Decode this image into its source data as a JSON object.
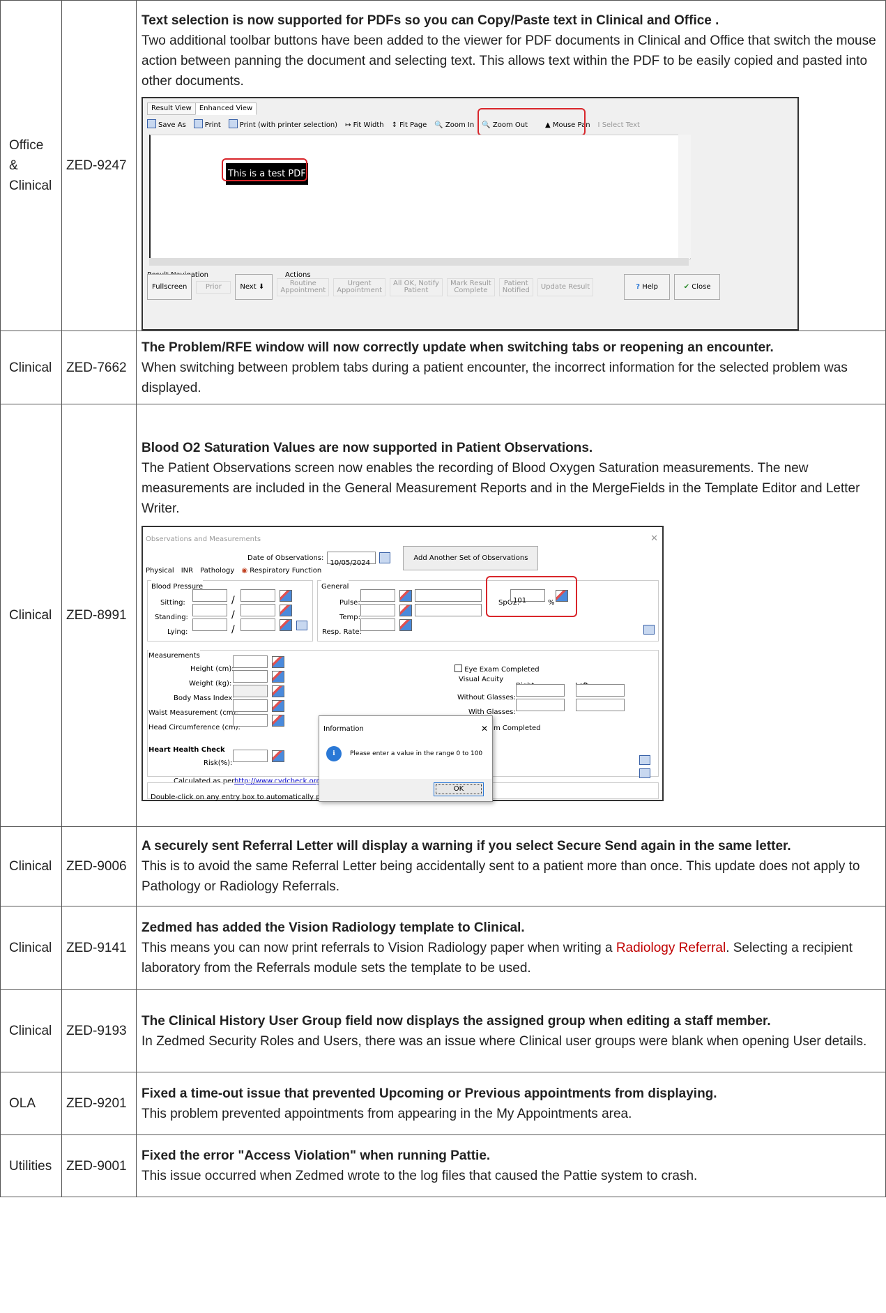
{
  "rows": [
    {
      "area": [
        "Office &",
        "Clinical"
      ],
      "code": "ZED-9247",
      "title": "Text selection is now supported for PDFs so you can Copy/Paste text in Clinical and Office .",
      "body": "Two additional toolbar buttons have been added to the viewer for PDF documents in Clinical and Office that switch the mouse action between panning the document and selecting text. This allows text within the PDF to be easily copied and pasted into other documents."
    },
    {
      "area": [
        "Clinical"
      ],
      "code": "ZED-7662",
      "title": "The Problem/RFE window will now correctly update when switching tabs or reopening an encounter.",
      "body": "When switching between problem tabs during a patient encounter, the incorrect information for the selected problem was displayed."
    },
    {
      "area": [
        "Clinical"
      ],
      "code": "ZED-8991",
      "title": "Blood O2 Saturation Values are now supported in Patient Observations.",
      "body": "The Patient Observations screen now enables the recording of Blood Oxygen Saturation measurements. The new measurements are included in the General Measurement Reports and in the MergeFields in the Template Editor and Letter Writer."
    },
    {
      "area": [
        "Clinical"
      ],
      "code": "ZED-9006",
      "title": "A securely sent Referral Letter will display a warning if you select Secure Send again in the same letter.",
      "body": "This is to avoid the same Referral Letter being accidentally sent to a patient more than once. This update does not apply to Pathology or Radiology Referrals."
    },
    {
      "area": [
        "Clinical"
      ],
      "code": "ZED-9141",
      "title": "Zedmed has added the Vision Radiology template to Clinical.",
      "body_pre": "This means you can now print referrals to Vision Radiology paper when writing a ",
      "body_link": "Radiology Referral",
      "body_post": ".  Selecting a recipient laboratory from the Referrals module sets the template to be used."
    },
    {
      "area": [
        "Clinical"
      ],
      "code": "ZED-9193",
      "title": "The Clinical History User Group field now displays the assigned group when editing a staff member.",
      "body": "In Zedmed Security Roles and Users, there was an issue where Clinical user groups were blank when opening User details."
    },
    {
      "area": [
        "OLA"
      ],
      "code": "ZED-9201",
      "title": "Fixed a time-out issue that prevented Upcoming or Previous appointments from displaying.",
      "body": "This problem prevented appointments from appearing in the My Appointments area."
    },
    {
      "area": [
        "Utilities"
      ],
      "code": "ZED-9001",
      "title": "Fixed the error \"Access Violation\" when running Pattie.",
      "body": "This issue occurred when Zedmed wrote to the log files that caused the Pattie system to crash."
    }
  ],
  "pdf_viewer": {
    "tabs": [
      "Result View",
      "Enhanced View"
    ],
    "toolbar": [
      "Save As",
      "Print",
      "Print (with printer selection)",
      "Fit Width",
      "Fit Page",
      "Zoom In",
      "Zoom Out",
      "Mouse Pan",
      "Select Text"
    ],
    "pdf_text": "This is a test PDF",
    "nav_label": "Result Navigation",
    "actions_label": "Actions",
    "nav_buttons": [
      "Fullscreen",
      "Prior",
      "Next"
    ],
    "action_buttons": [
      [
        "Routine",
        "Appointment"
      ],
      [
        "Urgent",
        "Appointment"
      ],
      [
        "All OK, Notify",
        "Patient"
      ],
      [
        "Mark Result",
        "Complete"
      ],
      [
        "Patient",
        "Notified"
      ],
      [
        "Update Result"
      ]
    ],
    "help": "Help",
    "close": "Close"
  },
  "observations": {
    "title": "Observations and Measurements",
    "date_label": "Date of Observations:",
    "date_value": "10/05/2024",
    "add_button": "Add Another Set of Observations",
    "tabs": [
      "Physical",
      "INR",
      "Pathology",
      "Respiratory Function"
    ],
    "bp_label": "Blood Pressure",
    "bp_rows": [
      "Sitting:",
      "Standing:",
      "Lying:"
    ],
    "general_label": "General",
    "general_rows": [
      "Pulse:",
      "Temp:",
      "Resp. Rate:"
    ],
    "spo2_label": "SpO2:",
    "spo2_value": "101",
    "spo2_unit": "%",
    "measurements_label": "Measurements",
    "measurement_rows": [
      "Height (cm):",
      "Weight (kg):",
      "Body Mass Index:",
      "Waist Measurement (cm):",
      "Head Circumference (cm):"
    ],
    "eye_exam": "Eye Exam Completed",
    "visual_acuity": "Visual Acuity",
    "right": "Right",
    "left": "Left",
    "without_glasses": "Without Glasses:",
    "with_glasses": "With Glasses:",
    "m_completed": "m Completed",
    "heart_label": "Heart Health Check",
    "risk": "Risk(%):",
    "calculated": "Calculated as per:",
    "calc_link": "http://www.cvdcheck.org.au",
    "hint": "Double-click on any entry box to automatically popula",
    "dialog_title": "Information",
    "dialog_message": "Please enter a value in the range 0 to 100",
    "dialog_ok": "OK"
  }
}
